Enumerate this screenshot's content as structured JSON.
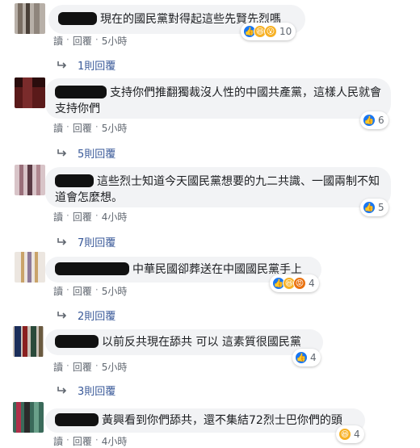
{
  "actions": {
    "read": "讀",
    "reply": "回覆",
    "sep": "·"
  },
  "comments": [
    {
      "text": "現在的國民黨對得起這些先賢先烈嗎",
      "reactions": [
        "like",
        "haha",
        "wow"
      ],
      "reaction_count": "10",
      "time": "5小時",
      "replies": "1則回覆"
    },
    {
      "text": "支持你們推翻獨裁沒人性的中國共產黨，這樣人民就會支持你們",
      "reactions": [
        "like"
      ],
      "reaction_count": "6",
      "time": "5小時",
      "replies": "5則回覆"
    },
    {
      "text": "這些烈士知道今天國民黨想要的九二共識、一國兩制不知道會怎麼想。",
      "reactions": [
        "like"
      ],
      "reaction_count": "5",
      "time": "4小時",
      "replies": "7則回覆"
    },
    {
      "text": "中華民國卻葬送在中國國民黨手上",
      "reactions": [
        "like",
        "haha",
        "angry"
      ],
      "reaction_count": "4",
      "time": "5小時",
      "replies": "2則回覆"
    },
    {
      "text": "以前反共現在舔共 可以 這素質很國民黨",
      "reactions": [
        "like"
      ],
      "reaction_count": "4",
      "time": "5小時",
      "replies": "3則回覆"
    },
    {
      "text": "黃興看到你們舔共，還不集結72烈士巴你們的頭",
      "reactions": [
        "haha"
      ],
      "reaction_count": "4",
      "time": "4小時",
      "replies": ""
    }
  ],
  "colors": {
    "bubble_bg": "#f2f3f5",
    "link": "#385898",
    "meta": "#606770",
    "like": "#1877f2",
    "haha": "#f7b125",
    "angry": "#e9710f"
  }
}
